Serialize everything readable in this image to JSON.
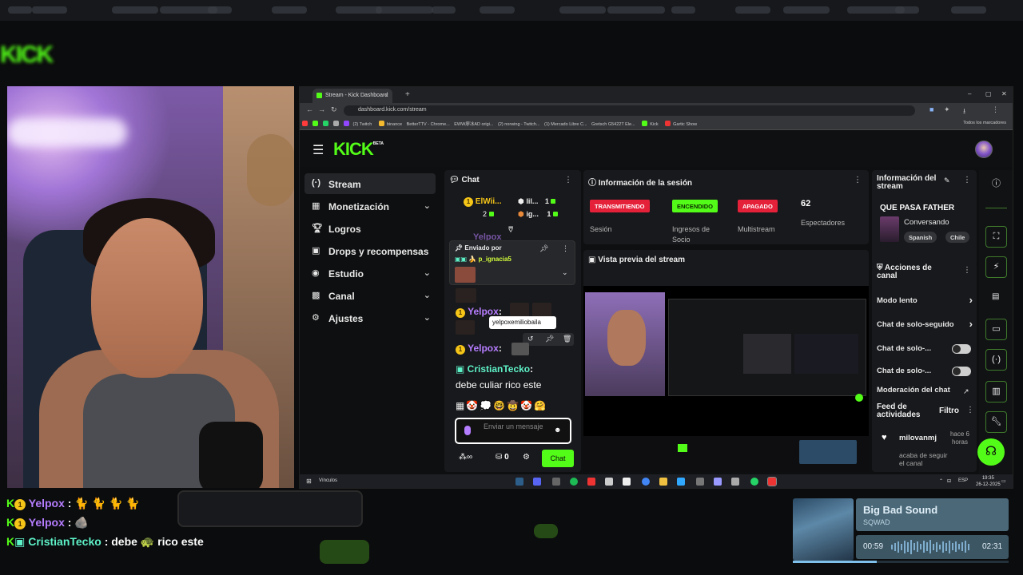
{
  "browser": {
    "tab_title": "Stream - Kick Dashboard",
    "url": "dashboard.kick.com/stream",
    "bookmarks": [
      "(2) Twitch",
      "binance",
      "BetterTTV - Chrome...",
      "EWW廖冰AD origi...",
      "(2) norwing - Twitch...",
      "(1) Mercado Libre C...",
      "Gretsch G5422T Ele...",
      "Kick",
      "Gartic Show"
    ],
    "all_bookmarks": "Todos los marcadores"
  },
  "kick": {
    "logo": "KICK",
    "beta": "BETA",
    "sidebar": [
      {
        "label": "Stream",
        "icon": "stream-icon"
      },
      {
        "label": "Monetización",
        "icon": "money-icon"
      },
      {
        "label": "Logros",
        "icon": "trophy-icon"
      },
      {
        "label": "Drops y recompensas",
        "icon": "gift-icon"
      },
      {
        "label": "Estudio",
        "icon": "studio-icon"
      },
      {
        "label": "Canal",
        "icon": "channel-icon"
      },
      {
        "label": "Ajustes",
        "icon": "gear-icon"
      }
    ],
    "chat": {
      "title": "Chat",
      "leaders": [
        {
          "name": "ElWii...",
          "rank": "1",
          "count": "2"
        },
        {
          "name": "lil...",
          "count": "1"
        },
        {
          "name": "ig...",
          "count": "1"
        }
      ],
      "pinned_label": "Enviado por",
      "pinned_user": "p_ignacia5",
      "truncated_user": "Yelpox",
      "messages": [
        {
          "user": "Yelpox",
          "text": ":"
        },
        {
          "user": "Yelpox",
          "text": ":"
        },
        {
          "user": "CristianTecko",
          "text": "debe culiar rico este"
        }
      ],
      "tooltip": "yelpoxemiliobaila",
      "input_placeholder": "Enviar un mensaje",
      "points": "0",
      "send_button": "Chat"
    },
    "session": {
      "title": "Información de la sesión",
      "items": [
        {
          "badge": "TRANSMITIENDO",
          "label": "Sesión",
          "color": "#e5213a"
        },
        {
          "badge": "ENCENDIDO",
          "label": "Ingresos de Socio",
          "color": "#53fc18"
        },
        {
          "badge": "APAGADO",
          "label": "Multistream",
          "color": "#e5213a"
        }
      ],
      "viewers": "62",
      "viewers_label": "Espectadores"
    },
    "preview": {
      "title": "Vista previa del stream"
    },
    "stream_info": {
      "title": "Información del stream",
      "stream_title": "QUE PASA FATHER",
      "category": "Conversando",
      "tags": [
        "Spanish",
        "Chile"
      ]
    },
    "channel_actions": {
      "title": "Acciones de canal",
      "rows": [
        {
          "label": "Modo lento",
          "type": "chevron"
        },
        {
          "label": "Chat de solo-seguido",
          "type": "chevron"
        },
        {
          "label": "Chat de solo-...",
          "type": "toggle"
        },
        {
          "label": "Chat de solo-...",
          "type": "toggle"
        },
        {
          "label": "Moderación del chat con IA",
          "type": "external"
        }
      ]
    },
    "feed": {
      "title": "Feed de actividades",
      "filter": "Filtro",
      "event_user": "milovanmj",
      "event_time": "hace 6 horas",
      "event_text": "acaba de seguir el canal"
    }
  },
  "taskbar": {
    "left_label": "Vínculos",
    "lang": "ESP",
    "time": "19:35",
    "date": "26-12-2025"
  },
  "overlay_chat": [
    {
      "user": "Yelpox",
      "text": ":",
      "emotes": "🐈 🐈 🐈 🐈"
    },
    {
      "user": "Yelpox",
      "text": ":",
      "emotes": "🪨"
    },
    {
      "user": "CristianTecko",
      "text": ": debe",
      "emotes": "🐢",
      "after": "rico este"
    }
  ],
  "music": {
    "title": "Big Bad Sound",
    "artist": "SQWAD",
    "elapsed": "00:59",
    "total": "02:31",
    "progress": 0.39
  },
  "colors": {
    "kick_green": "#53fc18",
    "red_badge": "#e5213a",
    "panel": "#18191c"
  }
}
